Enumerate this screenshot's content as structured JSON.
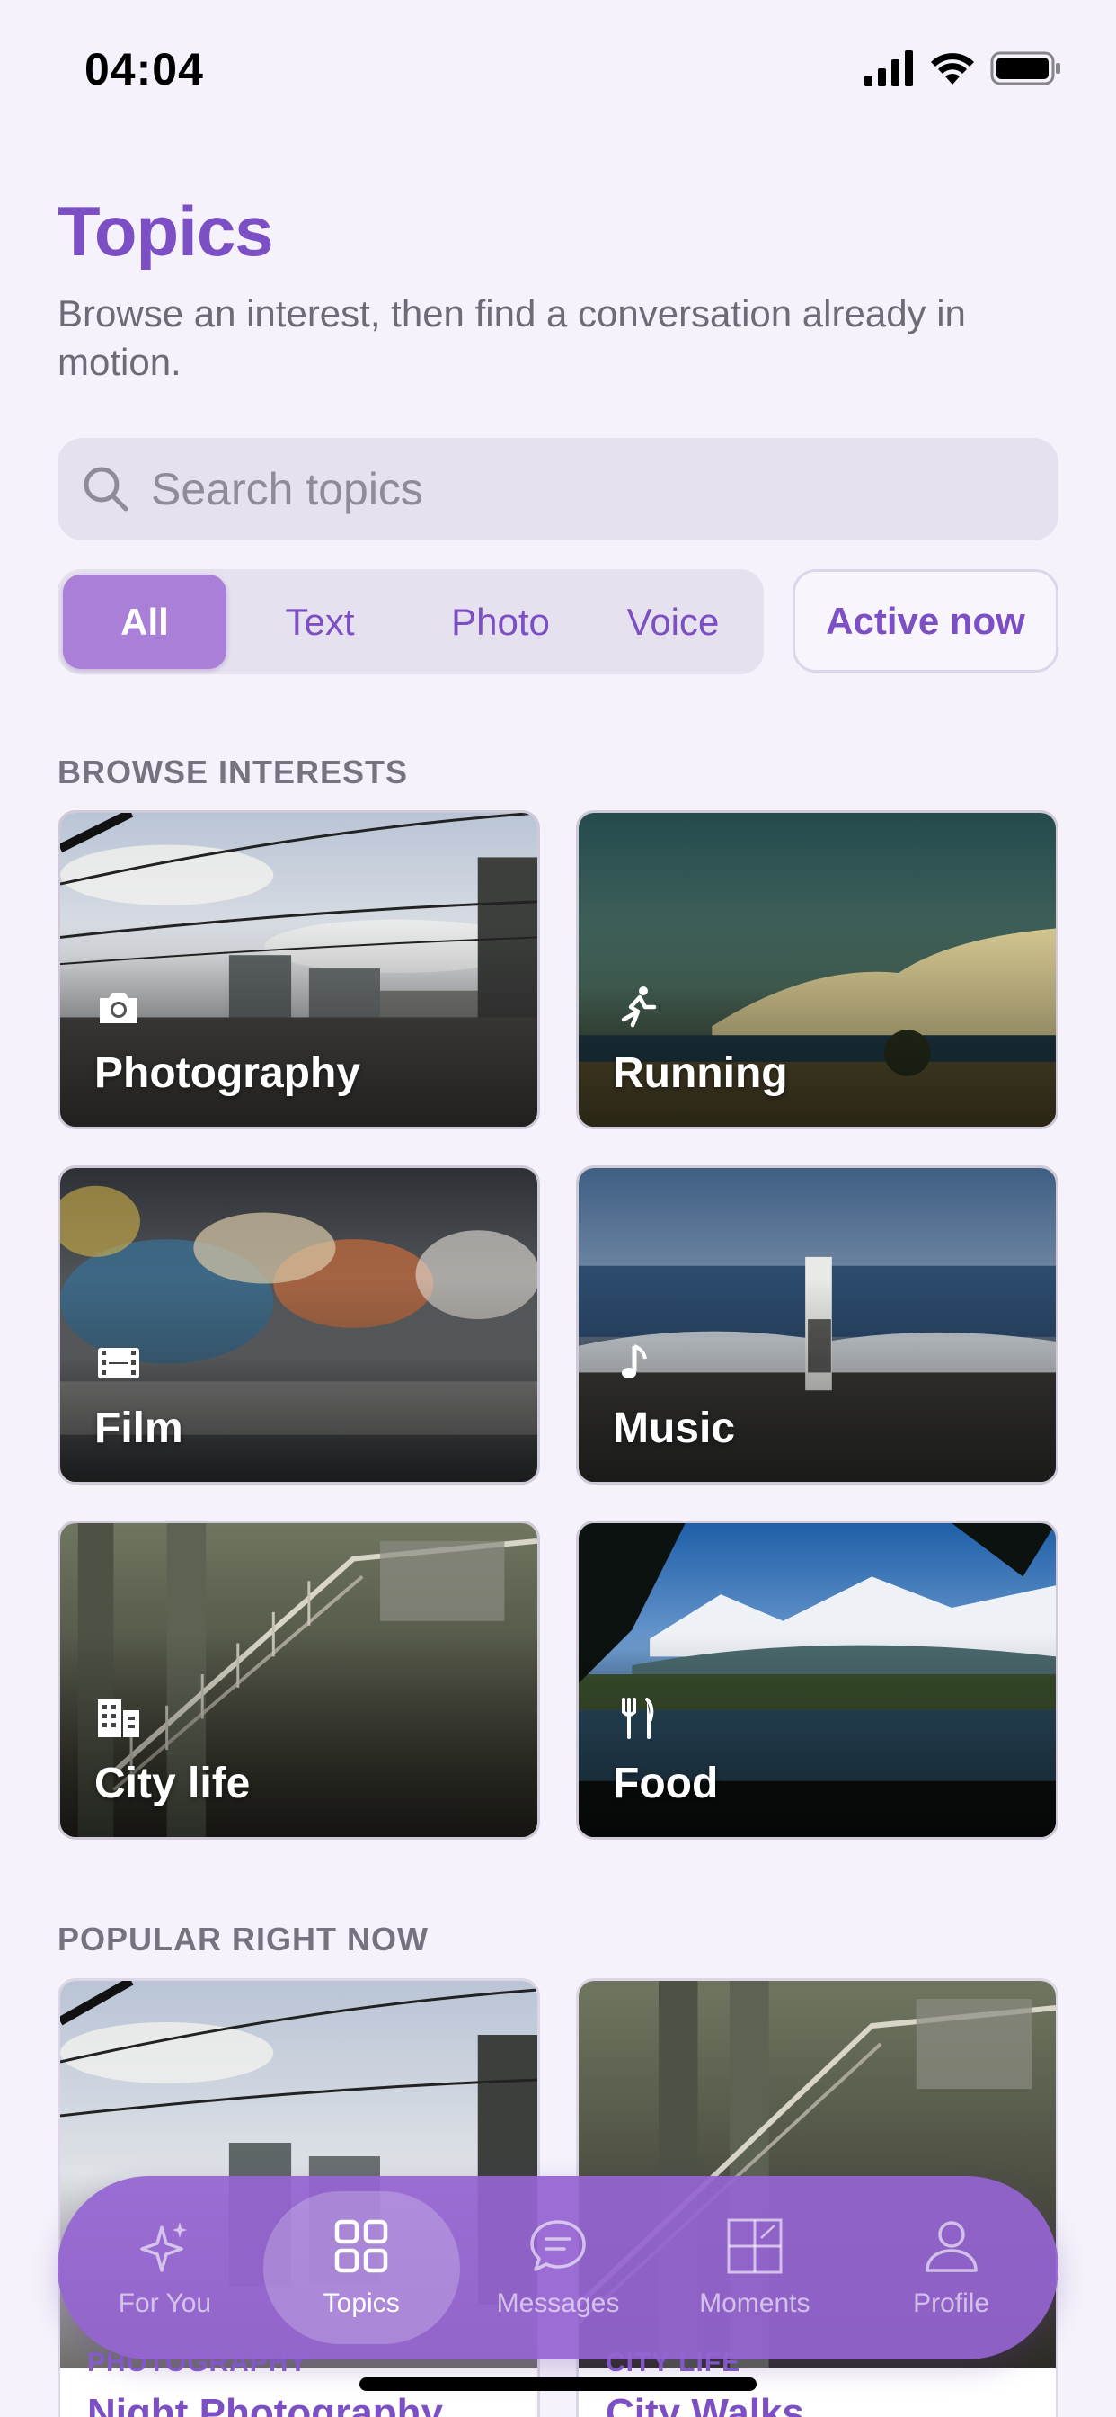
{
  "status": {
    "time": "04:04"
  },
  "header": {
    "title": "Topics",
    "subtitle": "Browse an interest, then find a conversation already in motion."
  },
  "search": {
    "placeholder": "Search topics",
    "value": ""
  },
  "filters": {
    "segments": [
      "All",
      "Text",
      "Photo",
      "Voice"
    ],
    "selected": "All",
    "active_now": "Active now"
  },
  "sections": {
    "browse": "BROWSE INTERESTS",
    "popular": "POPULAR RIGHT NOW"
  },
  "interests": [
    {
      "label": "Photography",
      "icon": "camera-icon"
    },
    {
      "label": "Running",
      "icon": "running-icon"
    },
    {
      "label": "Film",
      "icon": "film-icon"
    },
    {
      "label": "Music",
      "icon": "music-note-icon"
    },
    {
      "label": "City life",
      "icon": "building-icon"
    },
    {
      "label": "Food",
      "icon": "fork-knife-icon"
    }
  ],
  "popular": [
    {
      "category": "PHOTOGRAPHY",
      "title": "Night Photography"
    },
    {
      "category": "CITY LIFE",
      "title": "City Walks"
    }
  ],
  "tabbar": {
    "tabs": [
      {
        "label": "For You",
        "icon": "sparkle-icon"
      },
      {
        "label": "Topics",
        "icon": "grid-icon"
      },
      {
        "label": "Messages",
        "icon": "chat-bubble-icon"
      },
      {
        "label": "Moments",
        "icon": "moments-grid-icon"
      },
      {
        "label": "Profile",
        "icon": "person-icon"
      }
    ],
    "selected": "Topics"
  },
  "colors": {
    "accent": "#7c4fc4",
    "tabbar": "#9464d2",
    "background": "#f5f2fb"
  }
}
